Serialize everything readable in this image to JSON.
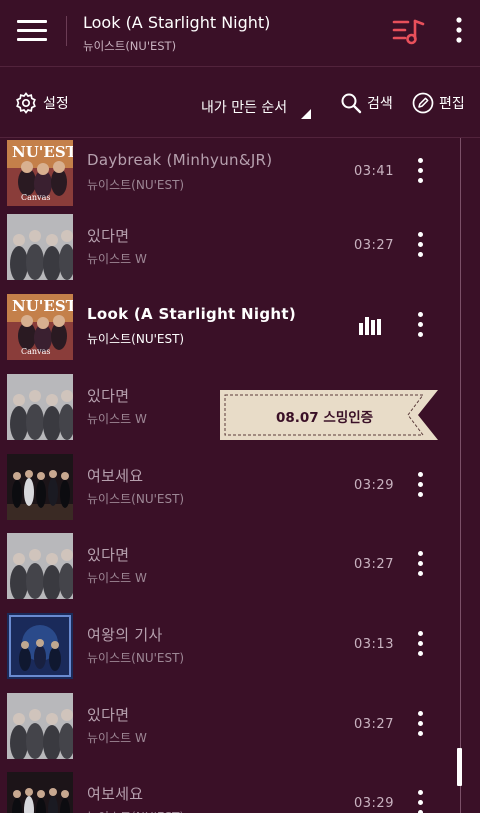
{
  "header": {
    "now_title": "Look (A Starlight Night)",
    "now_artist": "뉴이스트(NU'EST)",
    "menu_icon": "hamburger-menu-icon",
    "queue_icon": "playlist-music-icon",
    "more_icon": "more-vertical-icon",
    "accent": "#e8505b"
  },
  "toolbar": {
    "settings_label": "설정",
    "sort_label": "내가 만든 순서",
    "search_label": "검색",
    "edit_label": "편집"
  },
  "tracks": [
    {
      "title": "Daybreak (Minhyun&JR)",
      "artist": "뉴이스트(NU'EST)",
      "duration": "03:41",
      "art": "nuest"
    },
    {
      "title": "있다면",
      "artist": "뉴이스트 W",
      "duration": "03:27",
      "art": "w"
    },
    {
      "title": "Look (A Starlight Night)",
      "artist": "뉴이스트(NU'EST)",
      "duration": "",
      "art": "nuest",
      "playing": true
    },
    {
      "title": "있다면",
      "artist": "뉴이스트 W",
      "duration": "",
      "art": "w"
    },
    {
      "title": "여보세요",
      "artist": "뉴이스트(NU'EST)",
      "duration": "03:29",
      "art": "dark"
    },
    {
      "title": "있다면",
      "artist": "뉴이스트 W",
      "duration": "03:27",
      "art": "w"
    },
    {
      "title": "여왕의 기사",
      "artist": "뉴이스트(NU'EST)",
      "duration": "03:13",
      "art": "blue"
    },
    {
      "title": "있다면",
      "artist": "뉴이스트 W",
      "duration": "03:27",
      "art": "w"
    },
    {
      "title": "여보세요",
      "artist": "뉴이스트(NU'EST)",
      "duration": "03:29",
      "art": "dark"
    }
  ],
  "stamp": {
    "text": "08.07 스밍인증",
    "color": "#e8dcc8"
  },
  "album_text": {
    "logo": "NU'EST",
    "sub": "Canvas"
  }
}
